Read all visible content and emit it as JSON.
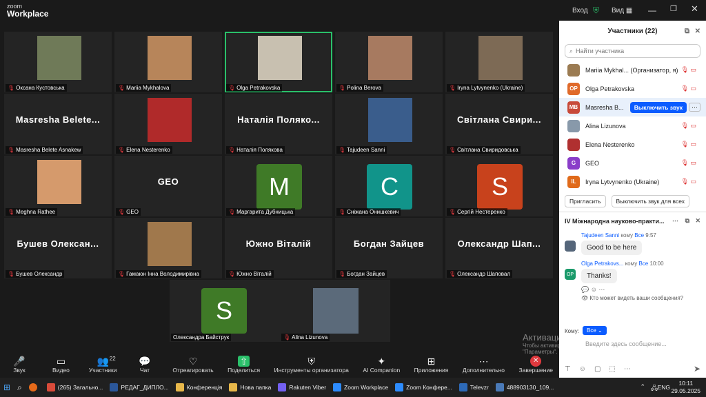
{
  "window": {
    "brand_top": "zoom",
    "brand_bottom": "Workplace",
    "signin": "Вход",
    "view": "Вид"
  },
  "tiles": [
    {
      "label": "Оксана Кустовська",
      "big": "",
      "kind": "photo",
      "color": "#6f7a58"
    },
    {
      "label": "Mariia Mykhalova",
      "big": "",
      "kind": "photo",
      "color": "#b7855a"
    },
    {
      "label": "Olga Petrakovska",
      "big": "",
      "kind": "photo",
      "color": "#c8c0b0",
      "active": true
    },
    {
      "label": "Polina Berova",
      "big": "",
      "kind": "photo",
      "color": "#a77a60"
    },
    {
      "label": "Iryna Lytvynenko (Ukraine)",
      "big": "",
      "kind": "photo",
      "color": "#7d6a55"
    },
    {
      "label": "Masresha Belete Asnakew",
      "big": "Masresha  Belete...",
      "kind": "name"
    },
    {
      "label": "Elena Nesterenko",
      "big": "",
      "kind": "photo",
      "color": "#b02a2a"
    },
    {
      "label": "Наталія Полякова",
      "big": "Наталія  Поляко...",
      "kind": "name"
    },
    {
      "label": "Tajudeen Sanni",
      "big": "",
      "kind": "photo",
      "color": "#3a5d8c"
    },
    {
      "label": "Світлана Свиридовська",
      "big": "Світлана  Свири...",
      "kind": "name"
    },
    {
      "label": "Meghna Rathee",
      "big": "",
      "kind": "photo",
      "color": "#d59a6c"
    },
    {
      "label": "GEO",
      "big": "GEO",
      "kind": "name"
    },
    {
      "label": "Маргарита Дубницька",
      "big": "M",
      "kind": "letter",
      "color": "#3f7a27"
    },
    {
      "label": "Сніжана Онишкевич",
      "big": "C",
      "kind": "letter",
      "color": "#11948a"
    },
    {
      "label": "Сергій Нестеренко",
      "big": "S",
      "kind": "letter",
      "color": "#c8421c"
    },
    {
      "label": "Бушев Олександр",
      "big": "Бушев  Олексан...",
      "kind": "name"
    },
    {
      "label": "Гамаюн Інна Володимирівна",
      "big": "",
      "kind": "photo",
      "color": "#a0784c"
    },
    {
      "label": "Южно Віталій",
      "big": "Южно  Віталій",
      "kind": "name"
    },
    {
      "label": "Богдан Зайцев",
      "big": "Богдан  Зайцев",
      "kind": "name"
    },
    {
      "label": "Олександр Шаповал",
      "big": "Олександр  Шап...",
      "kind": "name"
    }
  ],
  "bottom_tiles": [
    {
      "label": "Олександра Байструк",
      "big": "S",
      "color": "#3f7a27"
    },
    {
      "label": "Alina Lizunova",
      "big": "",
      "color": "#5b6a7a"
    }
  ],
  "controls": [
    {
      "icon": "mic-muted-icon",
      "glyph": "🎤",
      "label": "Звук"
    },
    {
      "icon": "video-icon",
      "glyph": "▭",
      "label": "Видео"
    },
    {
      "icon": "participants-icon",
      "glyph": "👥",
      "label": "Участники",
      "badge": "22"
    },
    {
      "icon": "chat-icon",
      "glyph": "💬",
      "label": "Чат"
    },
    {
      "icon": "react-icon",
      "glyph": "♡",
      "label": "Отреагировать"
    },
    {
      "icon": "share-icon",
      "glyph": "⇧",
      "label": "Поделиться"
    },
    {
      "icon": "host-tools-icon",
      "glyph": "⛨",
      "label": "Инструменты организатора"
    },
    {
      "icon": "ai-companion-icon",
      "glyph": "✦",
      "label": "AI Companion"
    },
    {
      "icon": "apps-icon",
      "glyph": "⊞",
      "label": "Приложения"
    },
    {
      "icon": "more-icon",
      "glyph": "⋯",
      "label": "Дополнительно"
    },
    {
      "icon": "end-icon",
      "glyph": "✕",
      "label": "Завершение"
    }
  ],
  "participants": {
    "title": "Участники (22)",
    "search_placeholder": "Найти участника",
    "rows": [
      {
        "initials": "",
        "name": "Mariia Mykhal...  (Организатор, я)",
        "color": "#9b7b52",
        "photo": true
      },
      {
        "initials": "OP",
        "name": "Olga Petrakovska",
        "color": "#e06a2a"
      },
      {
        "initials": "MB",
        "name": "Masresha B...",
        "color": "#c84a3a",
        "action": "Выключить звук"
      },
      {
        "initials": "",
        "name": "Alina Lizunova",
        "color": "#8899aa",
        "photo": true
      },
      {
        "initials": "",
        "name": "Elena Nesterenko",
        "color": "#b03030",
        "photo": true
      },
      {
        "initials": "G",
        "name": "GEO",
        "color": "#8a3dc9"
      },
      {
        "initials": "IL",
        "name": "Iryna Lytvynenko (Ukraine)",
        "color": "#e06a1a"
      }
    ],
    "invite": "Пригласить",
    "unmute_all": "Выключить звук для всех"
  },
  "chat": {
    "title": "IV Міжнародна науково-практи...",
    "messages": [
      {
        "sender": "Tajudeen Sanni",
        "to": "кому",
        "target": "Все",
        "time": "9:57",
        "text": "Good to be here",
        "avatar": "#55667a"
      },
      {
        "sender": "Olga Petrakovs...",
        "to": "кому",
        "target": "Все",
        "time": "10:00",
        "text": "Thanks!",
        "avatar": "#1a9a6a",
        "initials": "OP"
      }
    ],
    "who_can_see": "Кто может видеть ваши сообщения?",
    "to_label": "Кому:",
    "to_value": "Все",
    "input_placeholder": "Введите здесь сообщение..."
  },
  "watermark": {
    "line1": "Активация Windows",
    "line2": "Чтобы активировать Windows, перейдите в раздел",
    "line3": "\"Параметры\"."
  },
  "taskbar": {
    "items": [
      {
        "label": "(265) Загально...",
        "color": "#d94b3a"
      },
      {
        "label": "РЕДАГ_ДИПЛО...",
        "color": "#2b579a"
      },
      {
        "label": "Конференція",
        "color": "#e8b84a"
      },
      {
        "label": "Нова папка",
        "color": "#e8b84a"
      },
      {
        "label": "Rakuten Viber",
        "color": "#7360f2"
      },
      {
        "label": "Zoom Workplace",
        "color": "#2d8cff"
      },
      {
        "label": "Zoom Конфере...",
        "color": "#2d8cff"
      },
      {
        "label": "Televzr",
        "color": "#2d6ab8"
      },
      {
        "label": "488903130_109...",
        "color": "#4a7ab8"
      }
    ],
    "lang": "ENG",
    "time": "10:11",
    "date": "29.05.2025"
  }
}
